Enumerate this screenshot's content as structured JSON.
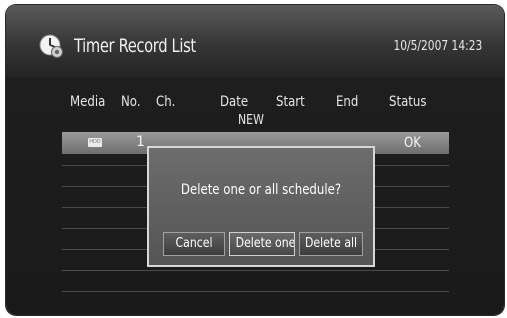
{
  "header": {
    "title": "Timer Record List",
    "datetime": "10/5/2007 14:23",
    "icon": "clock-timer-icon"
  },
  "columns": [
    "Media",
    "No.",
    "Ch.",
    "Date",
    "Start",
    "End",
    "Status"
  ],
  "new_label": "NEW",
  "records": [
    {
      "media_icon": "hdd-icon",
      "no": "1",
      "status": "OK"
    }
  ],
  "dialog": {
    "message": "Delete one or all schedule?",
    "buttons": [
      {
        "label": "Cancel"
      },
      {
        "label": "Delete one"
      },
      {
        "label": "Delete all"
      }
    ]
  }
}
